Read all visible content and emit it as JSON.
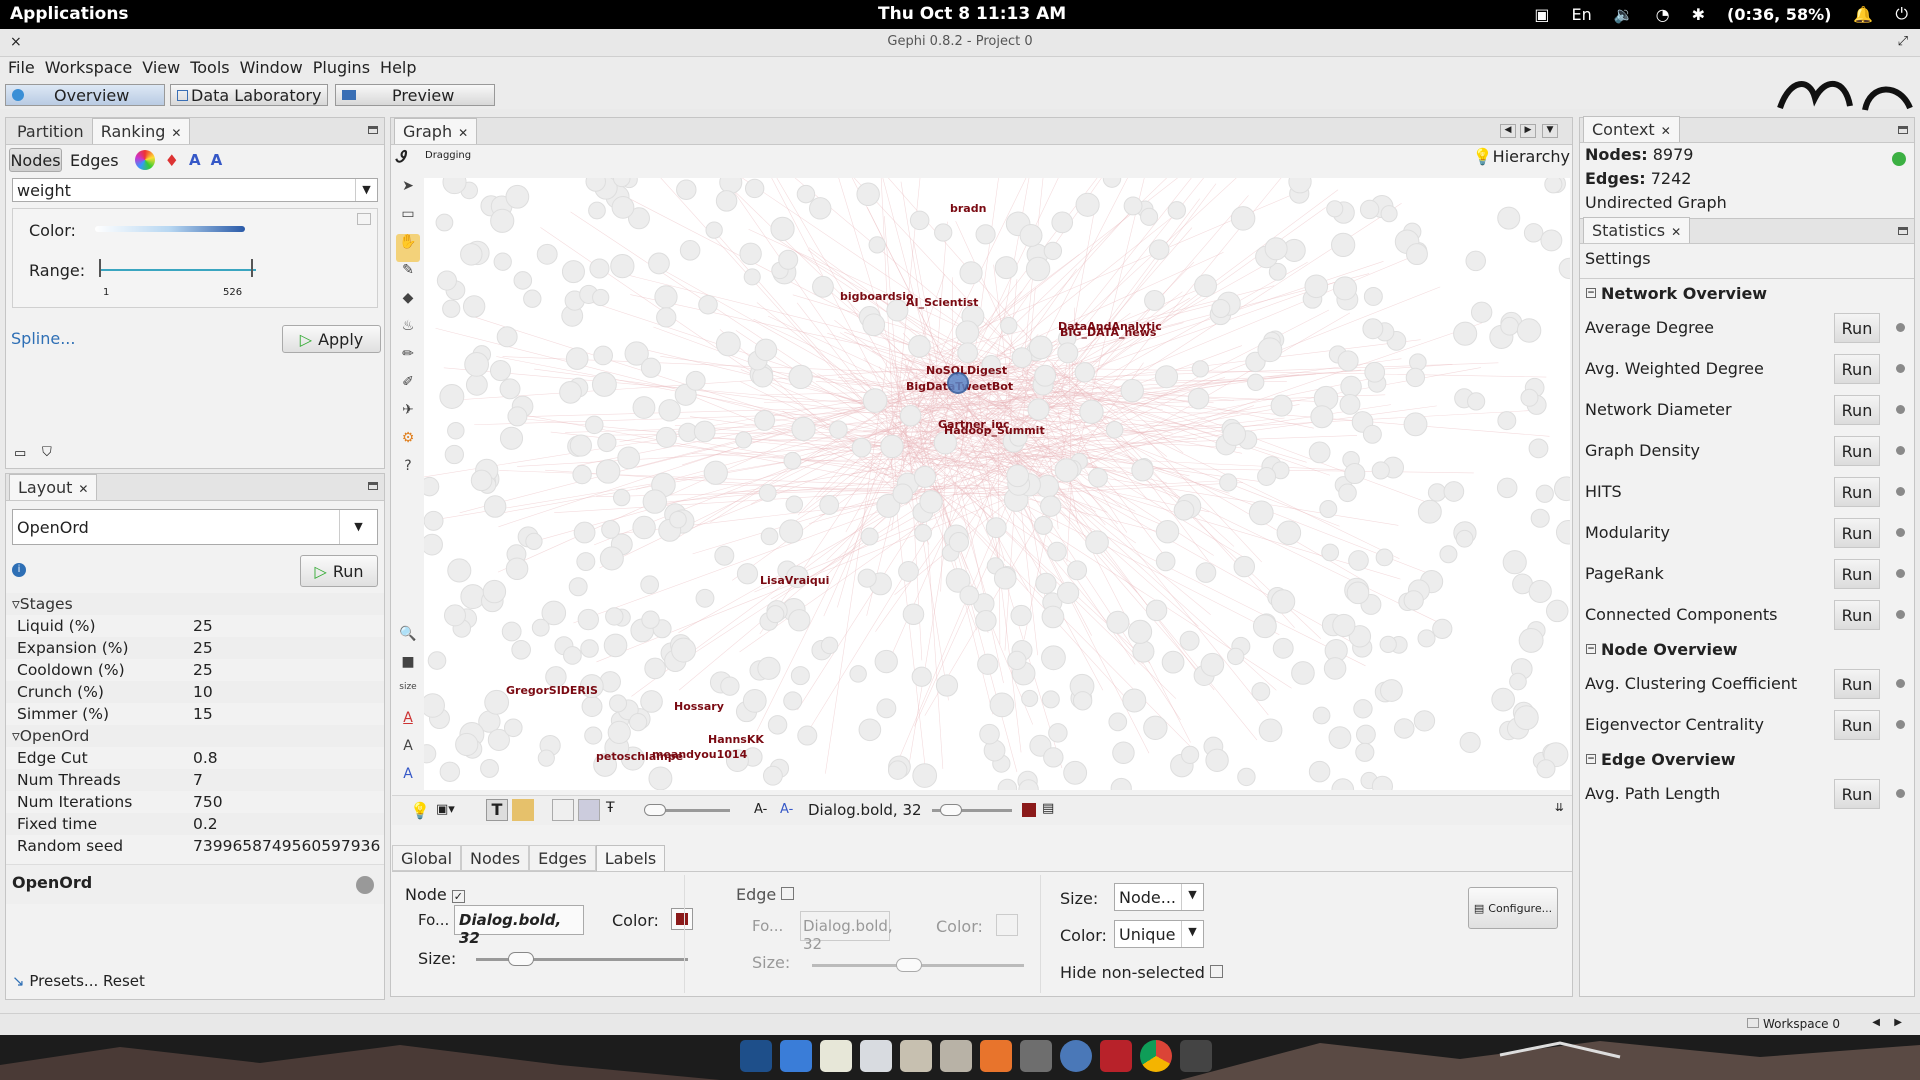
{
  "topbar": {
    "apps_label": "Applications",
    "clock": "Thu Oct  8    11:13 AM",
    "keyboard": "En",
    "battery": "(0:36, 58%)"
  },
  "window": {
    "title": "Gephi 0.8.2 - Project 0",
    "close": "×"
  },
  "menu": [
    "File",
    "Workspace",
    "View",
    "Tools",
    "Window",
    "Plugins",
    "Help"
  ],
  "perspectives": {
    "overview": "Overview",
    "data_lab": "Data Laboratory",
    "preview": "Preview"
  },
  "ranking": {
    "tab_partition": "Partition",
    "tab_ranking": "Ranking",
    "sub_nodes": "Nodes",
    "sub_edges": "Edges",
    "attribute": "weight",
    "color_label": "Color:",
    "range_label": "Range:",
    "range_min": "1",
    "range_max": "526",
    "spline": "Spline...",
    "apply": "Apply"
  },
  "layout": {
    "tab": "Layout",
    "algorithm": "OpenOrd",
    "run": "Run",
    "section_stages": "Stages",
    "section_openord": "OpenOrd",
    "stages": [
      {
        "k": "Liquid (%)",
        "v": "25"
      },
      {
        "k": "Expansion (%)",
        "v": "25"
      },
      {
        "k": "Cooldown (%)",
        "v": "25"
      },
      {
        "k": "Crunch (%)",
        "v": "10"
      },
      {
        "k": "Simmer (%)",
        "v": "15"
      }
    ],
    "openord": [
      {
        "k": "Edge Cut",
        "v": "0.8"
      },
      {
        "k": "Num Threads",
        "v": "7"
      },
      {
        "k": "Num Iterations",
        "v": "750"
      },
      {
        "k": "Fixed time",
        "v": "0.2"
      },
      {
        "k": "Random seed",
        "v": "7399658749560597936"
      }
    ],
    "footer_title": "OpenOrd",
    "presets": "Presets...",
    "reset": "Reset"
  },
  "graph": {
    "tab": "Graph",
    "mode": "Dragging",
    "hierarchy": "Hierarchy",
    "font_display": "Dialog.bold, 32",
    "labels": [
      "bradn",
      "bigboardsio",
      "AI_Scientist",
      "DataAndAnalytic",
      "BIG_DATA_news",
      "NoSQLDigest",
      "BigDataTweetBot",
      "Gartner_inc",
      "Hadoop_Summit",
      "LisaVraiqui",
      "GregorSIDERIS",
      "Hossary",
      "HannsKK",
      "meandyou1014",
      "petoschlampe"
    ]
  },
  "label_tabs": {
    "global": "Global",
    "nodes": "Nodes",
    "edges": "Edges",
    "labels": "Labels",
    "node": "Node",
    "edge": "Edge",
    "font_short": "Fo...",
    "node_font": "Dialog.bold, 32",
    "edge_font": "Dialog.bold, 32",
    "color": "Color:",
    "size": "Size:",
    "size_mode": "Node...",
    "color_mode": "Unique",
    "hide": "Hide non-selected",
    "configure": "Configure..."
  },
  "context": {
    "tab": "Context",
    "nodes_label": "Nodes:",
    "nodes": "8979",
    "edges_label": "Edges:",
    "edges": "7242",
    "type": "Undirected Graph"
  },
  "statistics": {
    "tab": "Statistics",
    "settings": "Settings",
    "run": "Run",
    "sections": [
      {
        "title": "Network Overview",
        "items": [
          "Average Degree",
          "Avg. Weighted Degree",
          "Network Diameter",
          "Graph Density",
          "HITS",
          "Modularity",
          "PageRank",
          "Connected Components"
        ]
      },
      {
        "title": "Node Overview",
        "items": [
          "Avg. Clustering Coefficient",
          "Eigenvector Centrality"
        ]
      },
      {
        "title": "Edge Overview",
        "items": [
          "Avg. Path Length"
        ]
      }
    ]
  },
  "status": {
    "workspace": "Workspace 0"
  },
  "colors": {
    "label_red": "#7a0a12",
    "accent_blue": "#2e6fb5"
  }
}
